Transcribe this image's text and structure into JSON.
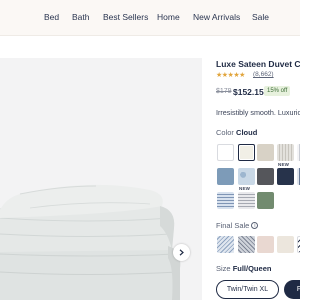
{
  "nav": {
    "items": [
      "Bed",
      "Bath",
      "Best Sellers",
      "Home",
      "New Arrivals",
      "Sale"
    ]
  },
  "product": {
    "title": "Luxe Sateen Duvet Cover Set",
    "rating": 4.5,
    "stars": "★★★★★",
    "review_count": "(8,662)",
    "old_price": "$179",
    "new_price": "$152.15",
    "discount": "15% off",
    "tagline": "Irresistibly smooth. Luxuriously soft."
  },
  "color": {
    "label": "Color",
    "selected": "Cloud",
    "new_tag": "NEW",
    "swatches": [
      {
        "name": "white",
        "color": "#ffffff"
      },
      {
        "name": "cloud",
        "color": "#f1efe6"
      },
      {
        "name": "sand",
        "color": "#d8d2c6"
      },
      {
        "name": "stripe-natural",
        "color": "#e3e1dc",
        "tag": "NEW"
      },
      {
        "name": "stripe-light",
        "color": "#f4f4f6"
      },
      {
        "name": "blue",
        "color": "#7d9bb8"
      },
      {
        "name": "blue-pattern",
        "color": "#c9d8e6",
        "tag": "NEW"
      },
      {
        "name": "charcoal",
        "color": "#55565b"
      },
      {
        "name": "navy",
        "color": "#27334b"
      },
      {
        "name": "stripe-navy",
        "color": "#dfe4ec"
      },
      {
        "name": "stripe-blue",
        "color": "#d7e1ee"
      },
      {
        "name": "stripe-gray",
        "color": "#e9e9ec"
      },
      {
        "name": "sage",
        "color": "#728b6f"
      }
    ]
  },
  "final_sale": {
    "label": "Final Sale",
    "info_icon": "i",
    "swatches": [
      {
        "name": "wave-blue",
        "color": "#dfe6ef"
      },
      {
        "name": "wave-gray",
        "color": "#cfd3da"
      },
      {
        "name": "blush",
        "color": "#e9d8d1"
      },
      {
        "name": "sand-light",
        "color": "#ece6dd"
      },
      {
        "name": "stripe-navy-diag",
        "color": "#ffffff"
      }
    ]
  },
  "size": {
    "label": "Size",
    "selected": "Full/Queen",
    "options": [
      "Twin/Twin XL",
      "Full/Queen"
    ]
  },
  "colors": {
    "brand": "#1f2a44",
    "star": "#e1a53d",
    "discount_bg": "#e7f1dd",
    "discount_text": "#3b6b35",
    "gallery_bg": "#f3f3f4"
  },
  "icons": {
    "next": "chevron-right-icon"
  }
}
